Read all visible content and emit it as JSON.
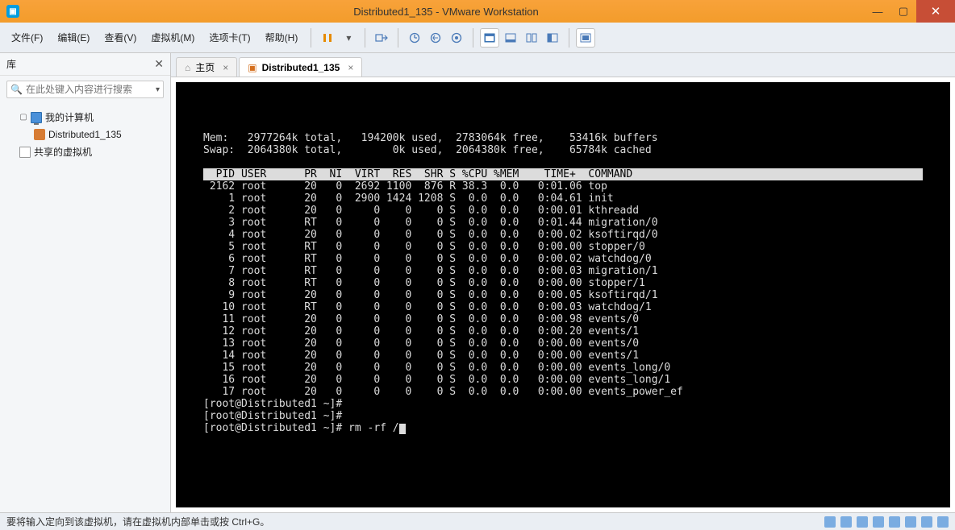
{
  "window": {
    "title": "Distributed1_135 - VMware Workstation",
    "min_glyph": "—",
    "max_glyph": "▢",
    "close_glyph": "✕"
  },
  "menu": {
    "items": [
      "文件(F)",
      "编辑(E)",
      "查看(V)",
      "虚拟机(M)",
      "选项卡(T)",
      "帮助(H)"
    ]
  },
  "sidebar": {
    "title": "库",
    "close_glyph": "✕",
    "search_placeholder": "在此处键入内容进行搜索",
    "dropdown_glyph": "▾",
    "tree": {
      "root_label": "我的计算机",
      "vm_label": "Distributed1_135",
      "shared_label": "共享的虚拟机"
    }
  },
  "tabs": {
    "home_label": "主页",
    "vm_label": "Distributed1_135"
  },
  "terminal": {
    "mem_line": "Mem:   2977264k total,   194200k used,  2783064k free,    53416k buffers",
    "swap_line": "Swap:  2064380k total,        0k used,  2064380k free,    65784k cached",
    "header": "  PID USER      PR  NI  VIRT  RES  SHR S %CPU %MEM    TIME+  COMMAND         ",
    "processes": [
      " 2162 root      20   0  2692 1100  876 R 38.3  0.0   0:01.06 top",
      "    1 root      20   0  2900 1424 1208 S  0.0  0.0   0:04.61 init",
      "    2 root      20   0     0    0    0 S  0.0  0.0   0:00.01 kthreadd",
      "    3 root      RT   0     0    0    0 S  0.0  0.0   0:01.44 migration/0",
      "    4 root      20   0     0    0    0 S  0.0  0.0   0:00.02 ksoftirqd/0",
      "    5 root      RT   0     0    0    0 S  0.0  0.0   0:00.00 stopper/0",
      "    6 root      RT   0     0    0    0 S  0.0  0.0   0:00.02 watchdog/0",
      "    7 root      RT   0     0    0    0 S  0.0  0.0   0:00.03 migration/1",
      "    8 root      RT   0     0    0    0 S  0.0  0.0   0:00.00 stopper/1",
      "    9 root      20   0     0    0    0 S  0.0  0.0   0:00.05 ksoftirqd/1",
      "   10 root      RT   0     0    0    0 S  0.0  0.0   0:00.03 watchdog/1",
      "   11 root      20   0     0    0    0 S  0.0  0.0   0:00.98 events/0",
      "   12 root      20   0     0    0    0 S  0.0  0.0   0:00.20 events/1",
      "   13 root      20   0     0    0    0 S  0.0  0.0   0:00.00 events/0",
      "   14 root      20   0     0    0    0 S  0.0  0.0   0:00.00 events/1",
      "   15 root      20   0     0    0    0 S  0.0  0.0   0:00.00 events_long/0",
      "   16 root      20   0     0    0    0 S  0.0  0.0   0:00.00 events_long/1",
      "   17 root      20   0     0    0    0 S  0.0  0.0   0:00.00 events_power_ef"
    ],
    "prompt1": "[root@Distributed1 ~]# ",
    "prompt2": "[root@Distributed1 ~]# ",
    "prompt3": "[root@Distributed1 ~]# rm -rf /"
  },
  "statusbar": {
    "text": "要将输入定向到该虚拟机，请在虚拟机内部单击或按 Ctrl+G。"
  }
}
